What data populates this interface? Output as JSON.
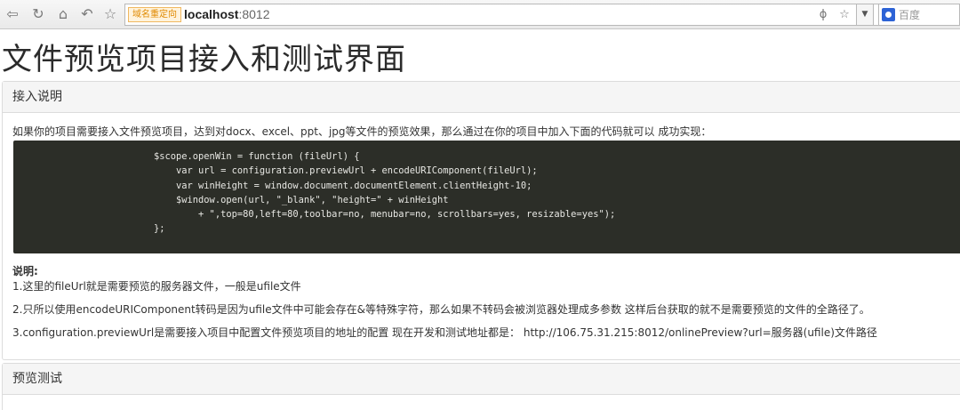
{
  "browser": {
    "redirect_badge": "域名重定向",
    "url_host": "localhost",
    "url_port": ":8012",
    "search_placeholder": "百度",
    "icons": [
      "back-icon",
      "refresh-icon",
      "home-icon",
      "undo-icon",
      "star-icon",
      "lightning-icon",
      "bookmark-star-icon",
      "dropdown-icon",
      "baidu-icon"
    ]
  },
  "page": {
    "title": "文件预览项目接入和测试界面"
  },
  "panel_access": {
    "heading": "接入说明",
    "intro": "如果你的项目需要接入文件预览项目，达到对docx、excel、ppt、jpg等文件的预览效果，那么通过在你的项目中加入下面的代码就可以 成功实现：",
    "code": "$scope.openWin = function (fileUrl) {\n    var url = configuration.previewUrl + encodeURIComponent(fileUrl);\n    var winHeight = window.document.documentElement.clientHeight-10;\n    $window.open(url, \"_blank\", \"height=\" + winHeight\n        + \",top=80,left=80,toolbar=no, menubar=no, scrollbars=yes, resizable=yes\");\n};",
    "note_title": "说明:",
    "notes": [
      "1.这里的fileUrl就是需要预览的服务器文件，一般是ufile文件",
      "2.只所以使用encodeURIComponent转码是因为ufile文件中可能会存在&等特殊字符，那么如果不转码会被浏览器处理成多参数 这样后台获取的就不是需要预览的文件的全路径了。",
      "3.configuration.previewUrl是需要接入项目中配置文件预览项目的地址的配置 现在开发和测试地址都是： http://106.75.31.215:8012/onlinePreview?url=服务器(ufile)文件路径"
    ]
  },
  "panel_test": {
    "heading": "预览测试"
  }
}
